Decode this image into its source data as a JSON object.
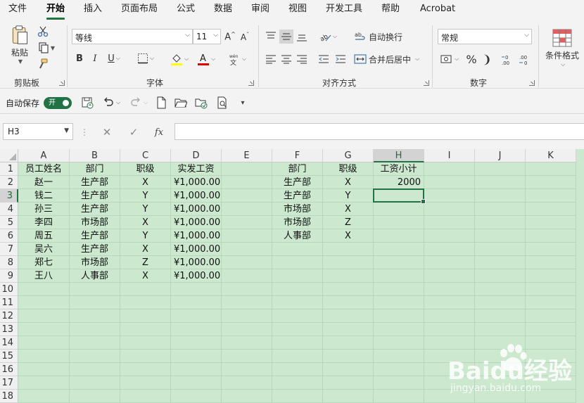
{
  "menu": {
    "tabs": [
      "文件",
      "开始",
      "插入",
      "页面布局",
      "公式",
      "数据",
      "审阅",
      "视图",
      "开发工具",
      "帮助",
      "Acrobat"
    ],
    "active": "开始"
  },
  "ribbon": {
    "clipboard": {
      "paste_label": "粘贴",
      "group_label": "剪贴板"
    },
    "font": {
      "font_name": "等线",
      "font_size": "11",
      "group_label": "字体"
    },
    "alignment": {
      "wrap_label": "自动换行",
      "merge_label": "合并后居中",
      "group_label": "对齐方式"
    },
    "number": {
      "format": "常规",
      "percent": "%",
      "comma": "❩",
      "group_label": "数字"
    },
    "styles": {
      "conditional_label": "条件格式"
    }
  },
  "qat": {
    "autosave_label": "自动保存",
    "toggle_label": "开"
  },
  "formula_bar": {
    "name_box": "H3",
    "formula": "",
    "fx": "fx"
  },
  "sheet": {
    "columns": [
      "A",
      "B",
      "C",
      "D",
      "E",
      "F",
      "G",
      "H",
      "I",
      "J",
      "K"
    ],
    "selected_column": "H",
    "selected_row": 3,
    "rows": [
      1,
      2,
      3,
      4,
      5,
      6,
      7,
      8,
      9,
      10,
      11,
      12,
      13,
      14,
      15,
      16,
      17,
      18
    ],
    "table": {
      "headers": [
        "员工姓名",
        "部门",
        "职级",
        "实发工资"
      ],
      "rows": [
        [
          "赵一",
          "生产部",
          "X",
          "¥1,000.00"
        ],
        [
          "钱二",
          "生产部",
          "Y",
          "¥1,000.00"
        ],
        [
          "孙三",
          "生产部",
          "Y",
          "¥1,000.00"
        ],
        [
          "李四",
          "市场部",
          "X",
          "¥1,000.00"
        ],
        [
          "周五",
          "生产部",
          "Y",
          "¥1,000.00"
        ],
        [
          "吴六",
          "生产部",
          "X",
          "¥1,000.00"
        ],
        [
          "郑七",
          "市场部",
          "Z",
          "¥1,000.00"
        ],
        [
          "王八",
          "人事部",
          "X",
          "¥1,000.00"
        ]
      ]
    },
    "criteria": {
      "headers": [
        "部门",
        "职级",
        "工资小计"
      ],
      "rows": [
        [
          "生产部",
          "X",
          "2000"
        ],
        [
          "生产部",
          "Y",
          ""
        ],
        [
          "市场部",
          "X",
          ""
        ],
        [
          "市场部",
          "Z",
          ""
        ],
        [
          "人事部",
          "X",
          ""
        ]
      ]
    }
  },
  "watermark": {
    "logo": "Baidu经验",
    "url": "jingyan.baidu.com"
  },
  "colors": {
    "accent": "#217346",
    "sheet_bg": "#cce8cf"
  }
}
